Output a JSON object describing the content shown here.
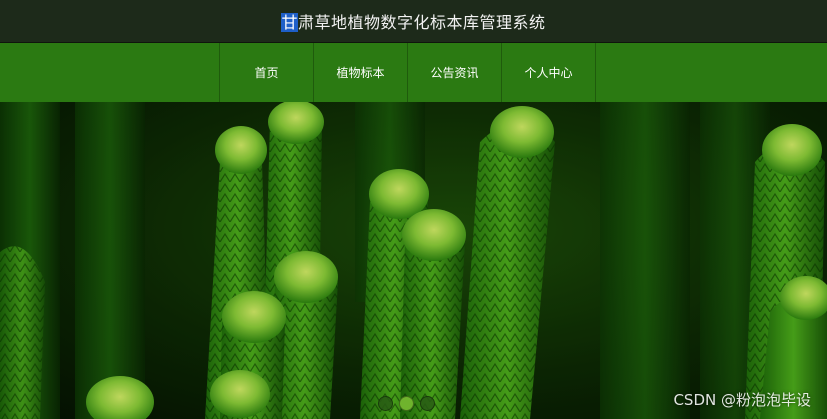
{
  "title_bar": {
    "selected_char": "甘",
    "title_rest": "肃草地植物数字化标本库管理系统"
  },
  "nav": {
    "items": [
      {
        "label": "首页"
      },
      {
        "label": "植物标本"
      },
      {
        "label": "公告资讯"
      },
      {
        "label": "个人中心"
      }
    ]
  },
  "carousel": {
    "active_index": 1,
    "slide_count": 3
  },
  "watermark": "CSDN @粉泡泡毕设",
  "colors": {
    "title_bar_bg": "#1d2a1a",
    "nav_bg": "#2b7a12",
    "accent": "#6fb32d"
  }
}
